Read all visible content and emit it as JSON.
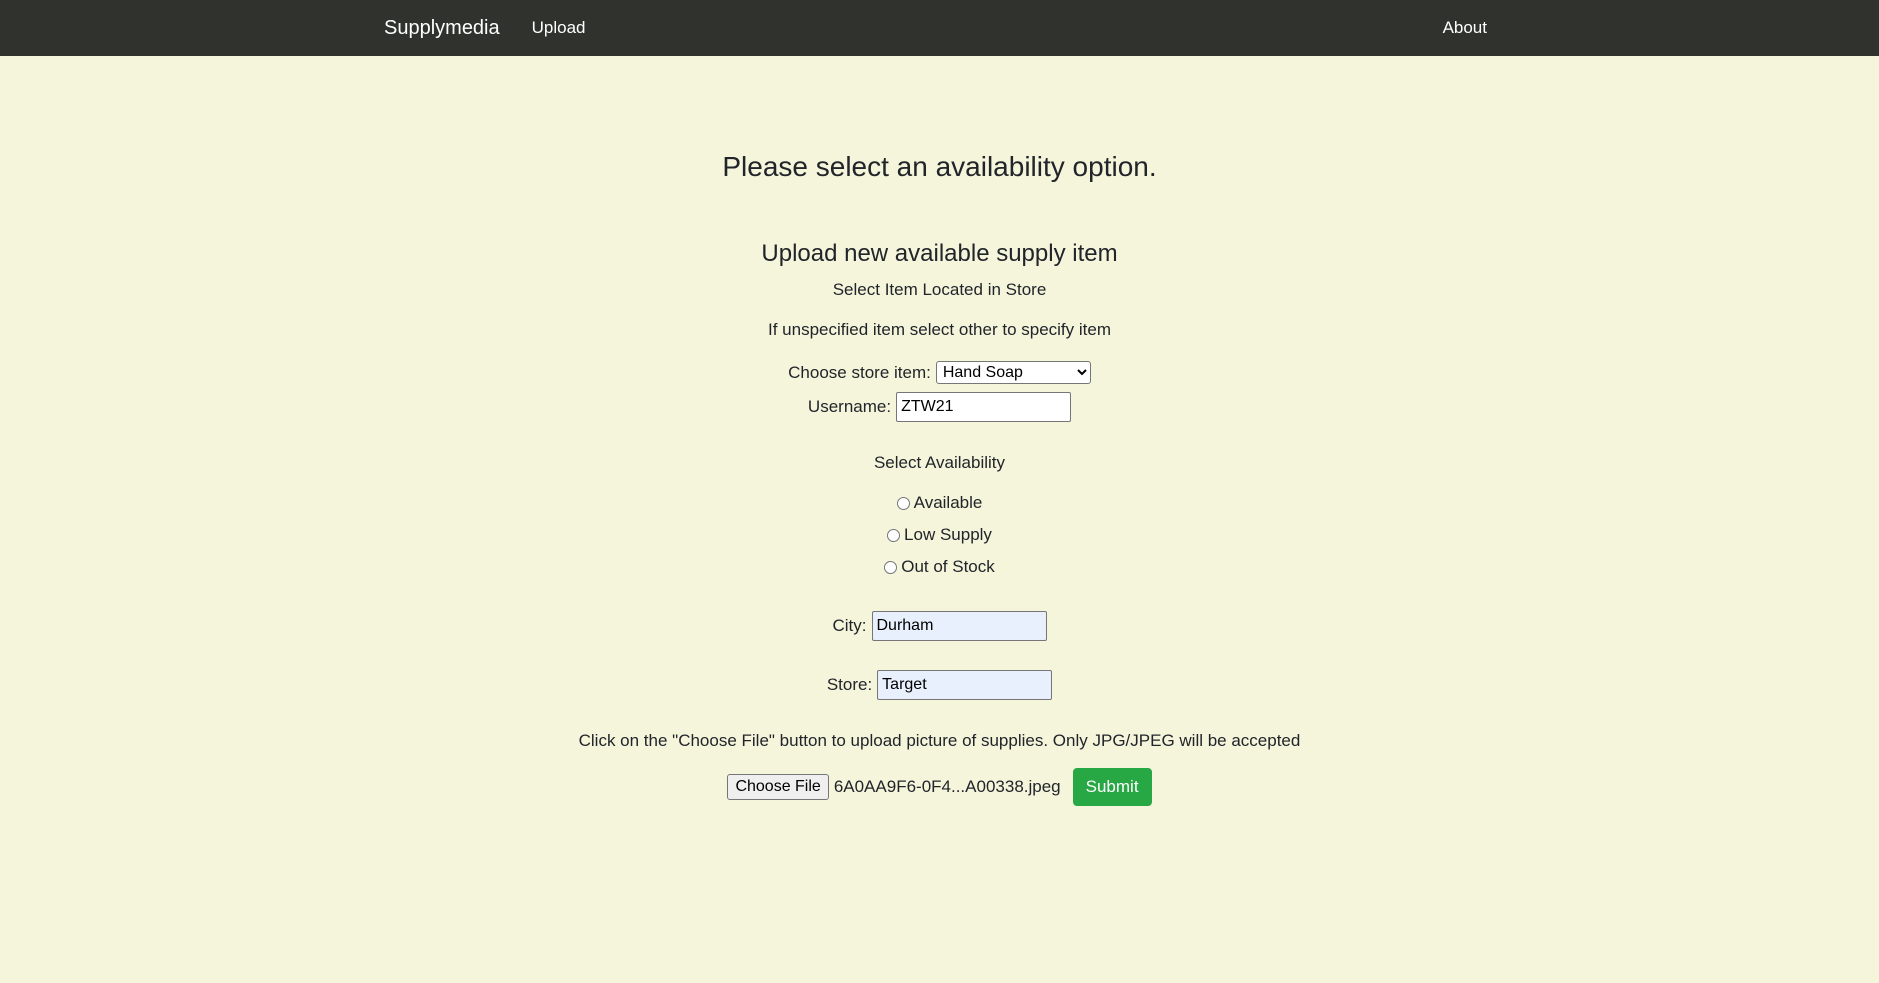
{
  "nav": {
    "brand": "Supplymedia",
    "upload": "Upload",
    "about": "About"
  },
  "page_title": "Please select an availability option.",
  "form": {
    "title": "Upload new available supply item",
    "subtitle": "Select Item Located in Store",
    "hint": "If unspecified item select other to specify item",
    "store_item_label": "Choose store item:",
    "store_item_value": "Hand Soap",
    "username_label": "Username:",
    "username_value": "ZTW21",
    "availability_heading": "Select Availability",
    "availability_options": [
      "Available",
      "Low Supply",
      "Out of Stock"
    ],
    "city_label": "City:",
    "city_value": "Durham",
    "store_label": "Store:",
    "store_value": "Target",
    "upload_instructions": "Click on the \"Choose File\" button to upload picture of supplies. Only JPG/JPEG will be accepted",
    "choose_file_label": "Choose File",
    "file_name": "6A0AA9F6-0F4...A00338.jpeg",
    "submit_label": "Submit"
  },
  "colors": {
    "navbar_bg": "#30322d",
    "page_bg": "#f5f5dc",
    "submit_bg": "#28a745"
  }
}
